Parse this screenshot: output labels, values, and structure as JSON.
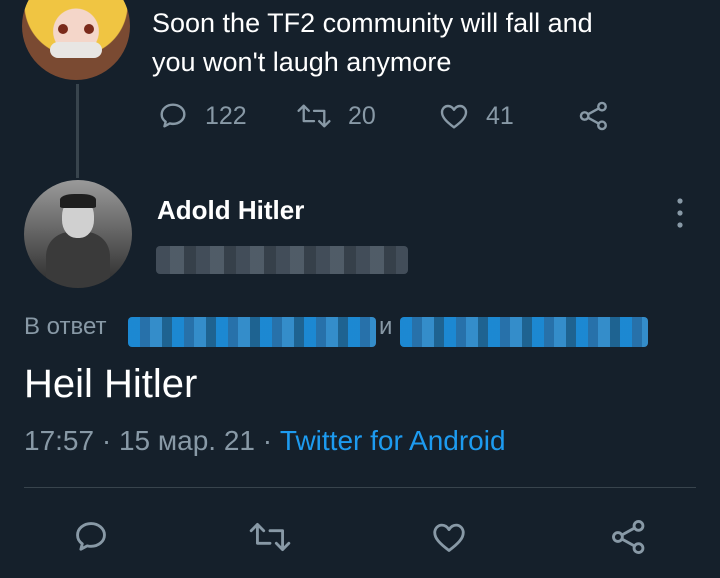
{
  "parent_tweet": {
    "text_line1": "Soon the TF2 community will fall and",
    "text_line2": "you won't laugh anymore",
    "replies": "122",
    "retweets": "20",
    "likes": "41"
  },
  "main_tweet": {
    "author_name": "Adold Hitler",
    "reply_prefix": "В ответ",
    "reply_conjunction": "и",
    "text": "Heil Hitler",
    "time": "17:57",
    "separator": "·",
    "date": "15 мар. 21",
    "source": "Twitter for Android"
  },
  "icons": {
    "reply": "reply-icon",
    "retweet": "retweet-icon",
    "like": "heart-icon",
    "share": "share-icon",
    "more": "more-vertical-icon"
  },
  "colors": {
    "background": "#15202b",
    "muted": "#8899a6",
    "accent": "#1d9bf0",
    "divider": "#38444d"
  }
}
